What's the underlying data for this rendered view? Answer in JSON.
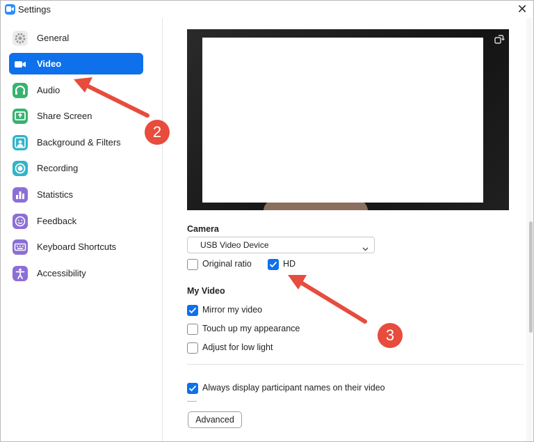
{
  "window": {
    "title": "Settings",
    "close_glyph": "✕"
  },
  "sidebar": {
    "items": [
      {
        "label": "General",
        "icon": "gear-icon",
        "color": "#bcbcbc",
        "active": false
      },
      {
        "label": "Video",
        "icon": "video-camera-icon",
        "color": "#0e71eb",
        "active": true
      },
      {
        "label": "Audio",
        "icon": "headphones-icon",
        "color": "#37b36f",
        "active": false
      },
      {
        "label": "Share Screen",
        "icon": "share-screen-icon",
        "color": "#37b36f",
        "active": false
      },
      {
        "label": "Background & Filters",
        "icon": "background-person-icon",
        "color": "#2fb4c8",
        "active": false
      },
      {
        "label": "Recording",
        "icon": "record-icon",
        "color": "#2fb4c8",
        "active": false
      },
      {
        "label": "Statistics",
        "icon": "bar-chart-icon",
        "color": "#8c6fd6",
        "active": false
      },
      {
        "label": "Feedback",
        "icon": "smiley-icon",
        "color": "#8c6fd6",
        "active": false
      },
      {
        "label": "Keyboard Shortcuts",
        "icon": "keyboard-icon",
        "color": "#8c6fd6",
        "active": false
      },
      {
        "label": "Accessibility",
        "icon": "accessibility-icon",
        "color": "#8c6fd6",
        "active": false
      }
    ]
  },
  "camera": {
    "title": "Camera",
    "selected_device": "USB Video Device",
    "original_ratio": {
      "label": "Original ratio",
      "checked": false
    },
    "hd": {
      "label": "HD",
      "checked": true
    }
  },
  "my_video": {
    "title": "My Video",
    "options": [
      {
        "label": "Mirror my video",
        "checked": true
      },
      {
        "label": "Touch up my appearance",
        "checked": false
      },
      {
        "label": "Adjust for low light",
        "checked": false
      }
    ]
  },
  "participants": {
    "label": "Always display participant names on their video",
    "checked": true
  },
  "advanced_button": "Advanced",
  "callouts": {
    "sidebar_step": "2",
    "hd_step": "3"
  },
  "colors": {
    "accent": "#0e71eb",
    "callout": "#e74c3c"
  }
}
